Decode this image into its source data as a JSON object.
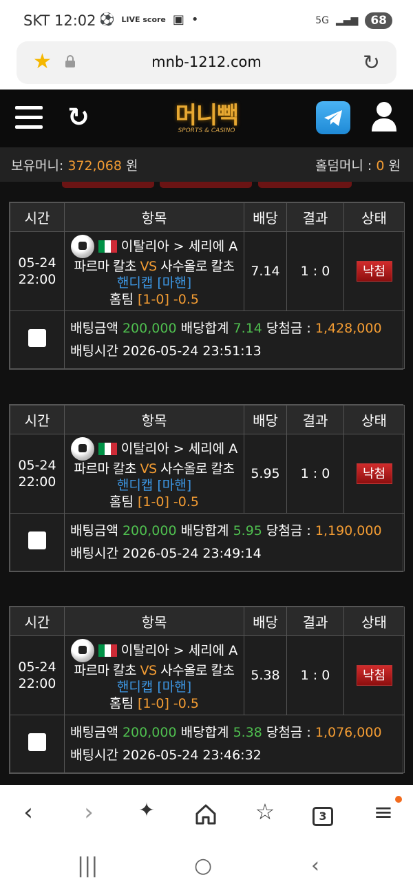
{
  "status_bar": {
    "carrier": "SKT",
    "time": "12:02",
    "live_label": "LIVE score",
    "network": "5G",
    "battery": "68"
  },
  "browser": {
    "url": "mnb-1212.com"
  },
  "header": {
    "logo_text": "머니빽",
    "logo_sub": "SPORTS & CASINO"
  },
  "wallet": {
    "balance_label": "보유머니:",
    "balance_value": "372,068",
    "balance_unit": "원",
    "holdem_label": "홀덤머니 :",
    "holdem_value": "0",
    "holdem_unit": "원"
  },
  "table_headers": {
    "time": "시간",
    "item": "항목",
    "odds": "배당",
    "result": "결과",
    "status": "상태"
  },
  "labels": {
    "bet_amount": "배팅금액",
    "odds_total": "배당합계",
    "win_amount": "당첨금 :",
    "bet_time": "배팅시간",
    "vs": "VS",
    "pick_prefix": "홈팀",
    "market_type": "핸디캡",
    "market_half": "[마핸]"
  },
  "bets": [
    {
      "date": "05-24",
      "time": "22:00",
      "league": "이탈리아 > 세리에 A",
      "home": "파르마 칼초",
      "away": "사수올로 칼초",
      "pick_line": "[1-0] -0.5",
      "odds": "7.14",
      "result": "1 : 0",
      "status": "낙첨",
      "amount": "200,000",
      "total_odds": "7.14",
      "win": "1,428,000",
      "bet_time": "2026-05-24 23:51:13"
    },
    {
      "date": "05-24",
      "time": "22:00",
      "league": "이탈리아 > 세리에 A",
      "home": "파르마 칼초",
      "away": "사수올로 칼초",
      "pick_line": "[1-0] -0.5",
      "odds": "5.95",
      "result": "1 : 0",
      "status": "낙첨",
      "amount": "200,000",
      "total_odds": "5.95",
      "win": "1,190,000",
      "bet_time": "2026-05-24 23:49:14"
    },
    {
      "date": "05-24",
      "time": "22:00",
      "league": "이탈리아 > 세리에 A",
      "home": "파르마 칼초",
      "away": "사수올로 칼초",
      "pick_line": "[1-0] -0.5",
      "odds": "5.38",
      "result": "1 : 0",
      "status": "낙첨",
      "amount": "200,000",
      "total_odds": "5.38",
      "win": "1,076,000",
      "bet_time": "2026-05-24 23:46:32"
    }
  ],
  "bottom_nav": {
    "tab_count": "3"
  },
  "colors": {
    "accent_orange": "#f39c33",
    "odds_green": "#4fbf4f",
    "market_blue": "#3d98e6",
    "lost_red": "#c0221f"
  }
}
